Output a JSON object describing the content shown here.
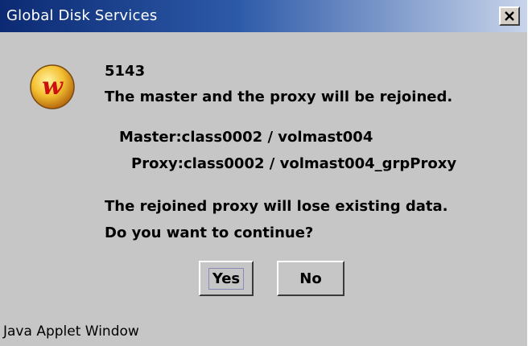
{
  "window": {
    "title": "Global Disk Services",
    "close_label": "X"
  },
  "dialog": {
    "icon": "warning-w-icon",
    "code": "5143",
    "message": "The master and the proxy will be rejoined.",
    "master_line": "Master:class0002 / volmast004",
    "proxy_line": "Proxy:class0002 / volmast004_grpProxy",
    "warning_line": "The rejoined proxy will lose existing data.",
    "question_line": "Do you want to continue?"
  },
  "buttons": {
    "yes_label": "Yes",
    "no_label": "No"
  },
  "status": {
    "text": "Java Applet Window"
  },
  "colors": {
    "title_gradient_start": "#0c2a73",
    "title_gradient_end": "#c8d4ea",
    "window_bg": "#c6c6c6",
    "icon_orange": "#f0a020",
    "icon_red": "#cc1010"
  }
}
